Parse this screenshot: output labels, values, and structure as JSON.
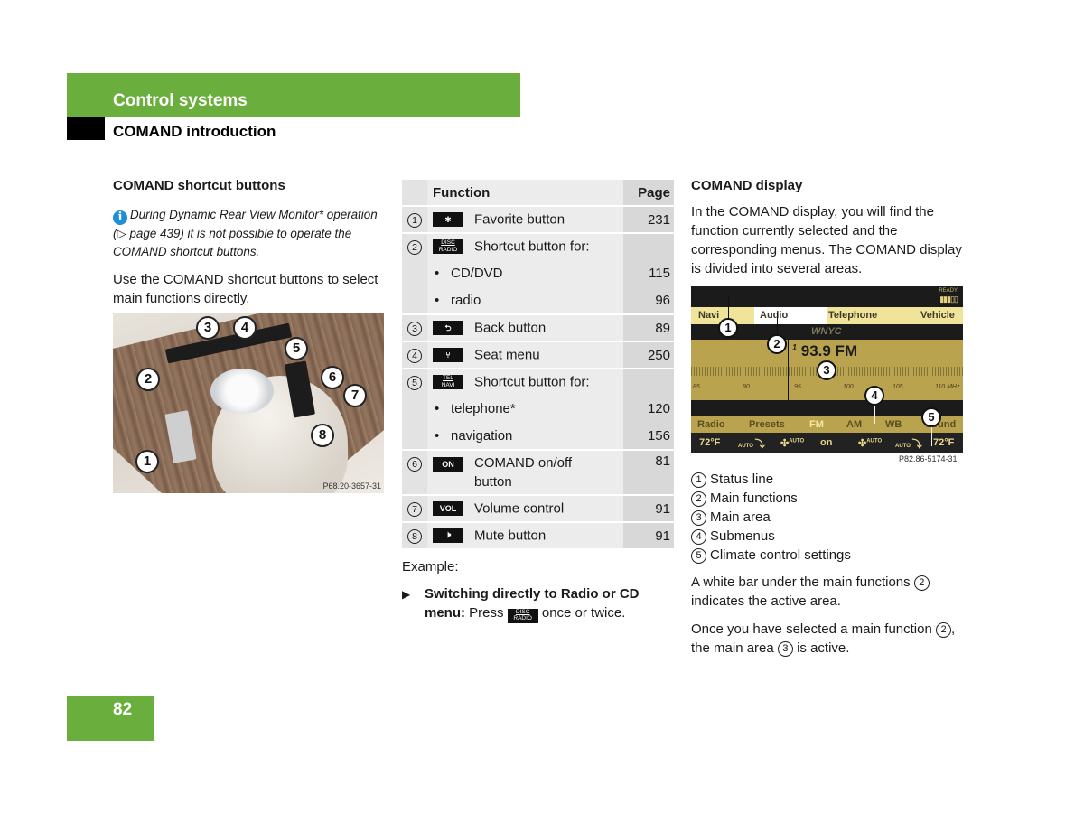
{
  "header": {
    "section": "Control systems",
    "subsection": "COMAND introduction"
  },
  "col1": {
    "heading": "COMAND shortcut buttons",
    "note_icon": "info-icon",
    "note": "During Dynamic Rear View Monitor* operation (▷ page 439) it is not possible to operate the COMAND shortcut buttons.",
    "para": "Use the COMAND shortcut buttons to select main functions directly.",
    "photo": {
      "code": "P68.20-3657-31",
      "callouts": [
        "1",
        "2",
        "3",
        "4",
        "5",
        "6",
        "7",
        "8"
      ]
    }
  },
  "table": {
    "headers": {
      "function": "Function",
      "page": "Page"
    },
    "rows": [
      {
        "num": "1",
        "key": "✱",
        "key_icon": "favorite-star-key",
        "text": "Favorite button",
        "page": "231"
      },
      {
        "num": "2",
        "key_top": "DISC",
        "key_bottom": "RADIO",
        "key_icon": "disc-radio-key",
        "text": "Shortcut button for:",
        "page": ""
      },
      {
        "bullet": "CD/DVD",
        "page": "115"
      },
      {
        "bullet": "radio",
        "page": "96"
      },
      {
        "num": "3",
        "key": "⮌",
        "key_icon": "back-arrow-key",
        "text": "Back button",
        "page": "89"
      },
      {
        "num": "4",
        "key": "⑂",
        "key_icon": "seat-key",
        "text": "Seat menu",
        "page": "250"
      },
      {
        "num": "5",
        "key_top": "TEL",
        "key_bottom": "NAVI",
        "key_icon": "tel-navi-key",
        "text": "Shortcut button for:",
        "page": ""
      },
      {
        "bullet": "telephone*",
        "page": "120"
      },
      {
        "bullet": "navigation",
        "page": "156"
      },
      {
        "num": "6",
        "key": "ON",
        "key_icon": "on-key",
        "text": "COMAND on/off button",
        "page": "81"
      },
      {
        "num": "7",
        "key": "VOL",
        "key_icon": "vol-key",
        "text": "Volume control",
        "page": "91"
      },
      {
        "num": "8",
        "key": "🔇",
        "key_icon": "mute-key",
        "text": "Mute button",
        "page": "91"
      }
    ]
  },
  "example": {
    "label": "Example:",
    "step_bold": "Switching directly to Radio or CD menu:",
    "step_press": "Press",
    "key_top": "DISC",
    "key_bottom": "RADIO",
    "step_end": "once or twice."
  },
  "col3": {
    "heading": "COMAND display",
    "para": "In the COMAND display, you will find the function currently selected and the corresponding menus. The COMAND display is divided into several areas.",
    "display": {
      "ready": "READY",
      "main_functions": [
        "Navi",
        "Audio",
        "Telephone",
        "Vehicle"
      ],
      "active_function": "Audio",
      "station": "WNYC",
      "frequency": "93.9 FM",
      "preset_marker": "1",
      "scale_ticks": [
        "85",
        "90",
        "95",
        "100",
        "105",
        "110 MHz"
      ],
      "submenus": [
        "Radio",
        "Presets",
        "FM",
        "AM",
        "WB",
        "Sound"
      ],
      "active_submenu": "FM",
      "climate": [
        "72°F",
        "AUTO",
        "AUTO",
        "on",
        "AUTO",
        "AUTO",
        "72°F"
      ],
      "code": "P82.86-5174-31"
    },
    "legend": [
      {
        "num": "1",
        "text": "Status line"
      },
      {
        "num": "2",
        "text": "Main functions"
      },
      {
        "num": "3",
        "text": "Main area"
      },
      {
        "num": "4",
        "text": "Submenus"
      },
      {
        "num": "5",
        "text": "Climate control settings"
      }
    ],
    "p2_a": "A white bar under the main functions",
    "p2_num": "2",
    "p2_b": "indicates the active area.",
    "p3_a": "Once you have selected a main function",
    "p3_num1": "2",
    "p3_b": ", the main area",
    "p3_num2": "3",
    "p3_c": "is active."
  },
  "page_number": "82"
}
